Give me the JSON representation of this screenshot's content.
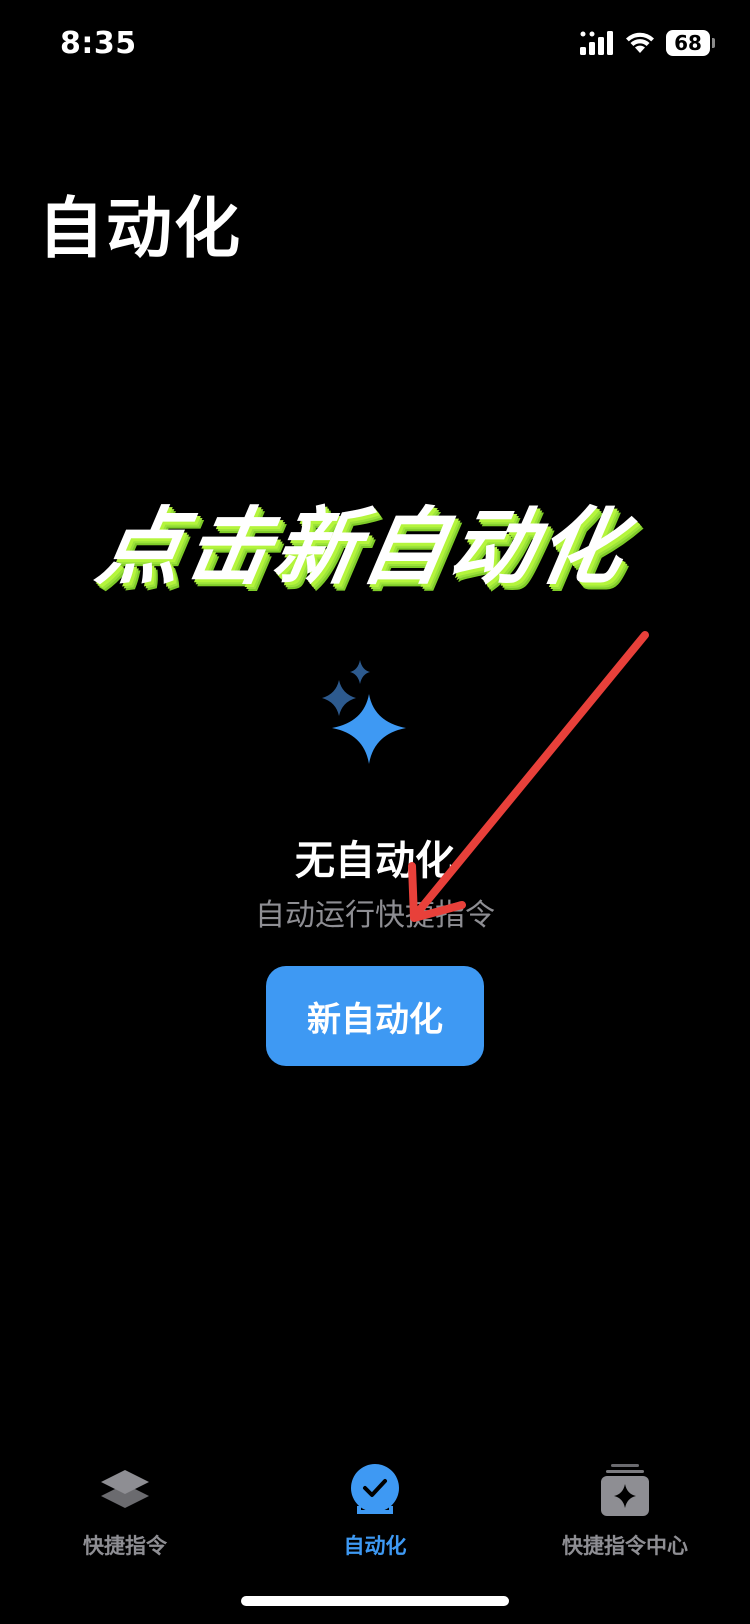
{
  "status_bar": {
    "time": "8:35",
    "battery": "68",
    "icons": [
      "signal-icon",
      "wifi-icon",
      "battery-icon"
    ]
  },
  "title": "自动化",
  "annotation": {
    "text": "点击新自动化",
    "arrow_color": "#e8403a",
    "text_color": "#ffffff",
    "shadow_color": "#b4f53c"
  },
  "empty_state": {
    "icon": "sparkles-icon",
    "title": "无自动化",
    "subtitle": "自动运行快捷指令",
    "button_label": "新自动化",
    "accent_color": "#3e99f3"
  },
  "tabs": [
    {
      "label": "快捷指令",
      "icon": "layers-icon",
      "active": false
    },
    {
      "label": "自动化",
      "icon": "checkmark-clock-icon",
      "active": true
    },
    {
      "label": "快捷指令中心",
      "icon": "gallery-icon",
      "active": false
    }
  ]
}
